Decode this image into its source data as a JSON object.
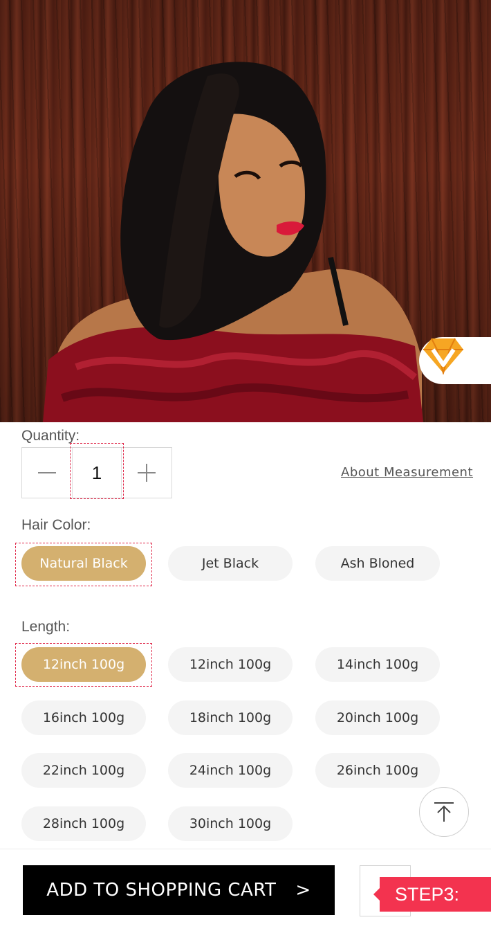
{
  "quantity": {
    "label": "Quantity:",
    "value": "1",
    "about_link": "About Measurement"
  },
  "hair_color": {
    "label": "Hair Color:",
    "options": [
      "Natural Black",
      "Jet Black",
      "Ash Bloned"
    ],
    "selected": "Natural Black"
  },
  "length": {
    "label": "Length:",
    "options": [
      "12inch 100g",
      "12inch 100g",
      "14inch 100g",
      "16inch 100g",
      "18inch 100g",
      "20inch 100g",
      "22inch 100g",
      "24inch 100g",
      "26inch 100g",
      "28inch 100g",
      "30inch 100g"
    ],
    "selected_index": 0
  },
  "cart": {
    "label": "ADD TO SHOPPING CART",
    "arrow": ">"
  },
  "step_tag": "STEP3:",
  "colors": {
    "accent_gold": "#d4b06f",
    "highlight_red": "#e0284a",
    "step_red": "#f3334f",
    "cart_black": "#000000"
  },
  "icons": {
    "badge": "vip-diamond-icon",
    "minus": "minus-icon",
    "plus": "plus-icon",
    "scroll_top": "arrow-up-to-top-icon"
  }
}
